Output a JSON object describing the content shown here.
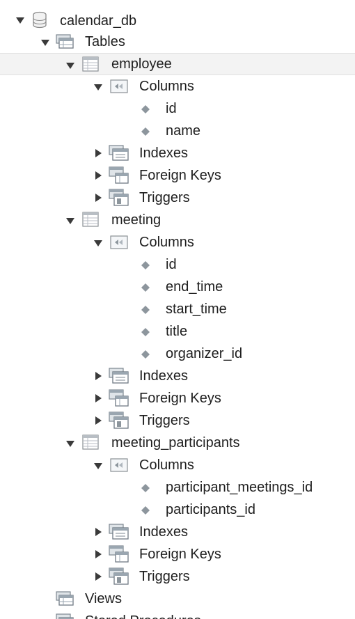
{
  "tree": {
    "database": {
      "label": "calendar_db",
      "icon": "database-icon",
      "expanded": true
    },
    "tables": {
      "label": "Tables",
      "icon": "tables-folder-icon",
      "expanded": true
    },
    "items": [
      {
        "table": "employee",
        "expanded": true,
        "selected": true,
        "columns_label": "Columns",
        "columns": [
          "id",
          "name"
        ],
        "indexes_label": "Indexes",
        "foreign_keys_label": "Foreign Keys",
        "triggers_label": "Triggers"
      },
      {
        "table": "meeting",
        "expanded": true,
        "selected": false,
        "columns_label": "Columns",
        "columns": [
          "id",
          "end_time",
          "start_time",
          "title",
          "organizer_id"
        ],
        "indexes_label": "Indexes",
        "foreign_keys_label": "Foreign Keys",
        "triggers_label": "Triggers"
      },
      {
        "table": "meeting_participants",
        "expanded": true,
        "selected": false,
        "columns_label": "Columns",
        "columns": [
          "participant_meetings_id",
          "participants_id"
        ],
        "indexes_label": "Indexes",
        "foreign_keys_label": "Foreign Keys",
        "triggers_label": "Triggers"
      }
    ],
    "views_label": "Views",
    "stored_procedures_label": "Stored Procedures"
  },
  "colors": {
    "arrow": "#3a3a3a",
    "diamond": "#8d969d",
    "selection": "#f3f3f3"
  }
}
